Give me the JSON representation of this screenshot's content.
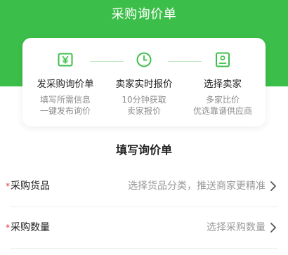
{
  "header": {
    "title": "采购询价单",
    "bg_color": "#3cbf4a"
  },
  "steps": [
    {
      "name": "发采购询价单",
      "desc_line1": "填写所需信息",
      "desc_line2": "一键发布询价",
      "icon": "yen-icon"
    },
    {
      "name": "卖家实时报价",
      "desc_line1": "10分钟获取",
      "desc_line2": "卖家报价",
      "icon": "clock-icon"
    },
    {
      "name": "选择卖家",
      "desc_line1": "多家比价",
      "desc_line2": "优选靠谱供应商",
      "icon": "contact-card-icon"
    }
  ],
  "form": {
    "title": "填写询价单",
    "rows": [
      {
        "required_mark": "*",
        "label": "采购货品",
        "value": "选择货品分类，推送商家更精准"
      },
      {
        "required_mark": "*",
        "label": "采购数量",
        "value": "选择采购数量"
      }
    ]
  }
}
